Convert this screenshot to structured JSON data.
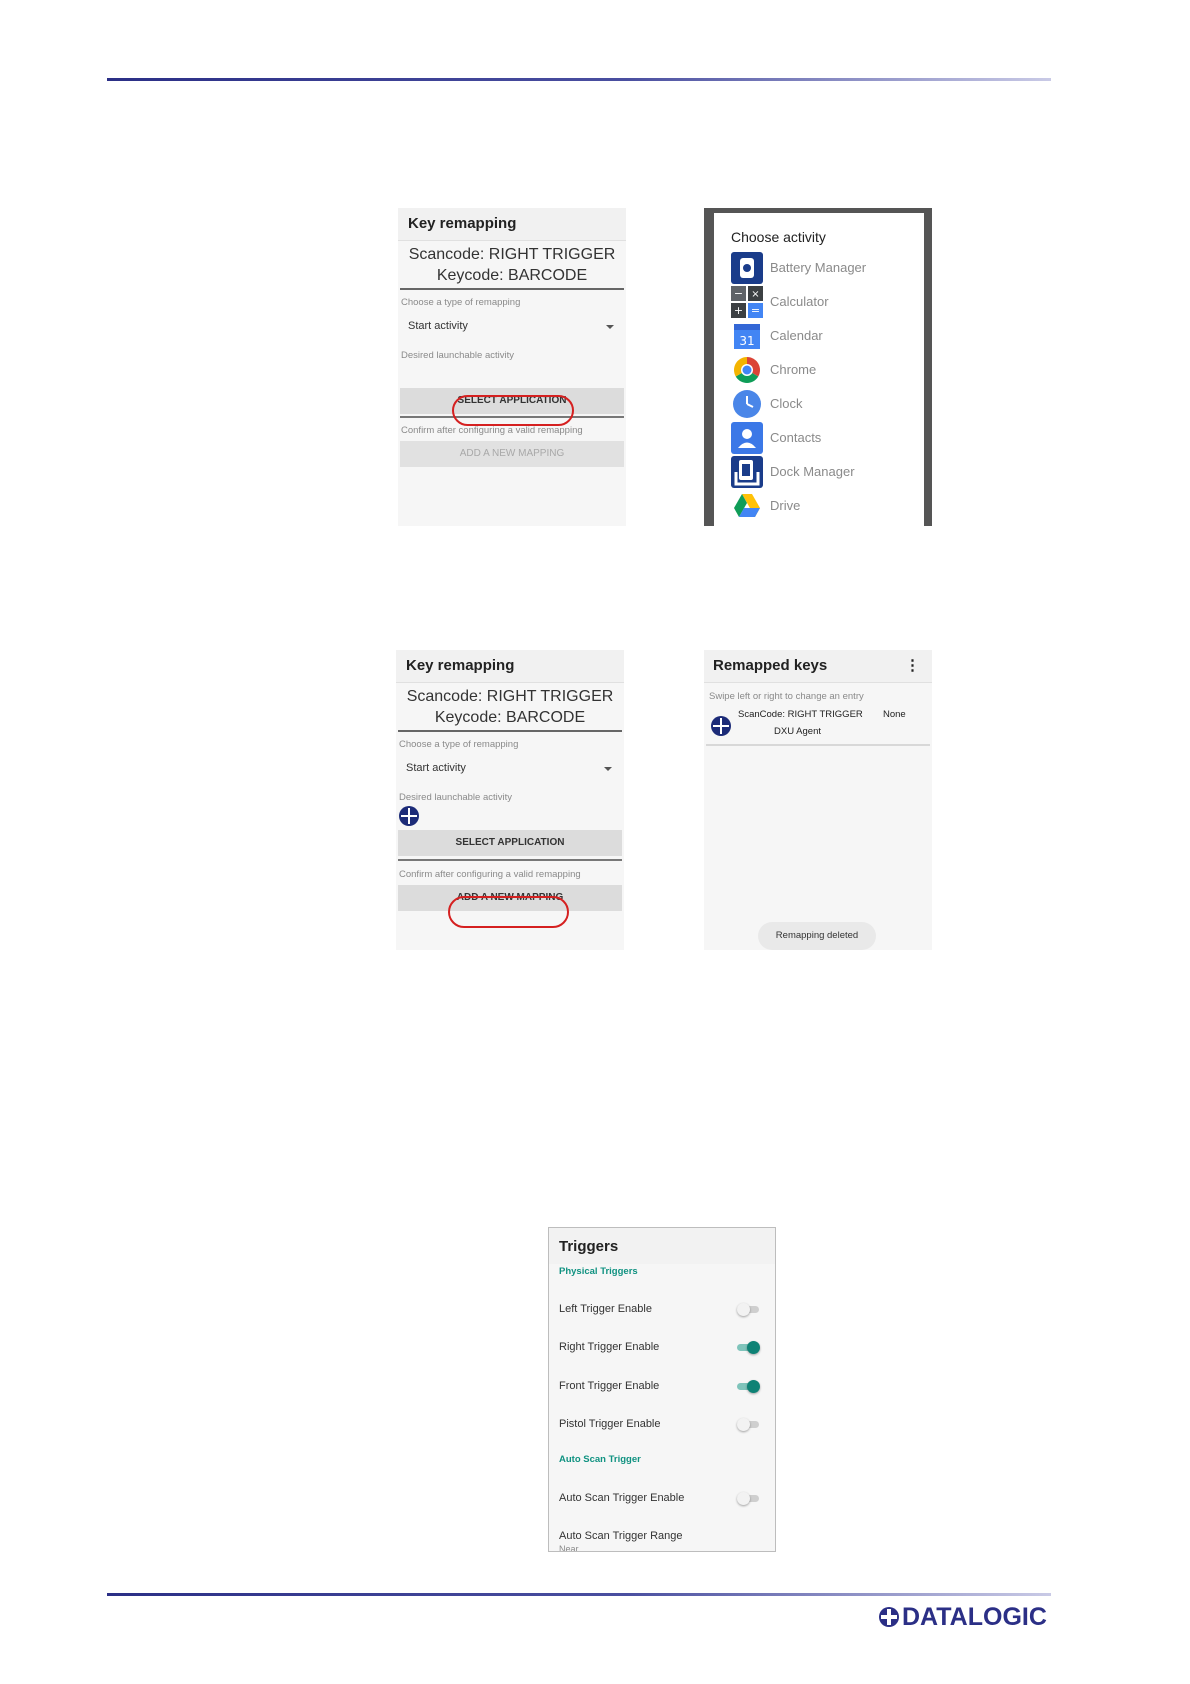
{
  "screen1": {
    "title": "Key remapping",
    "scancode": "Scancode: RIGHT TRIGGER",
    "keycode": "Keycode: BARCODE",
    "choose_label": "Choose a type of remapping",
    "type_value": "Start activity",
    "desired_label": "Desired launchable activity",
    "select_button": "SELECT APPLICATION",
    "confirm_label": "Confirm after configuring a valid remapping",
    "add_button": "ADD A NEW MAPPING"
  },
  "screen2": {
    "title": "Choose activity",
    "items": [
      {
        "label": "Battery Manager",
        "icon": "battery-manager-icon"
      },
      {
        "label": "Calculator",
        "icon": "calculator-icon"
      },
      {
        "label": "Calendar",
        "icon": "calendar-icon"
      },
      {
        "label": "Chrome",
        "icon": "chrome-icon"
      },
      {
        "label": "Clock",
        "icon": "clock-icon"
      },
      {
        "label": "Contacts",
        "icon": "contacts-icon"
      },
      {
        "label": "Dock Manager",
        "icon": "dock-manager-icon"
      },
      {
        "label": "Drive",
        "icon": "drive-icon"
      }
    ],
    "calendar_day": "31"
  },
  "screen3": {
    "title": "Key remapping",
    "scancode": "Scancode: RIGHT TRIGGER",
    "keycode": "Keycode: BARCODE",
    "choose_label": "Choose a type of remapping",
    "type_value": "Start activity",
    "desired_label": "Desired launchable activity",
    "select_button": "SELECT APPLICATION",
    "confirm_label": "Confirm after configuring a valid remapping",
    "add_button": "ADD A NEW MAPPING"
  },
  "screen4": {
    "title": "Remapped keys",
    "hint": "Swipe left or right to change an entry",
    "entry_scancode": "ScanCode: RIGHT TRIGGER",
    "entry_value": "None",
    "entry_app": "DXU Agent",
    "toast": "Remapping deleted"
  },
  "screen5": {
    "title": "Triggers",
    "section_physical": "Physical Triggers",
    "rows": [
      {
        "label": "Left Trigger Enable",
        "enabled": false
      },
      {
        "label": "Right Trigger Enable",
        "enabled": true
      },
      {
        "label": "Front Trigger Enable",
        "enabled": true
      },
      {
        "label": "Pistol Trigger Enable",
        "enabled": false
      }
    ],
    "section_auto": "Auto Scan Trigger",
    "auto_enable": {
      "label": "Auto Scan Trigger Enable",
      "enabled": false
    },
    "auto_range": "Auto Scan Trigger Range",
    "auto_range_value": "Near"
  },
  "footer": {
    "logo_text": "DATALOGIC",
    "brand_color": "#2b2f86",
    "accent_color": "#0e8275",
    "highlight_color": "#d52020"
  }
}
